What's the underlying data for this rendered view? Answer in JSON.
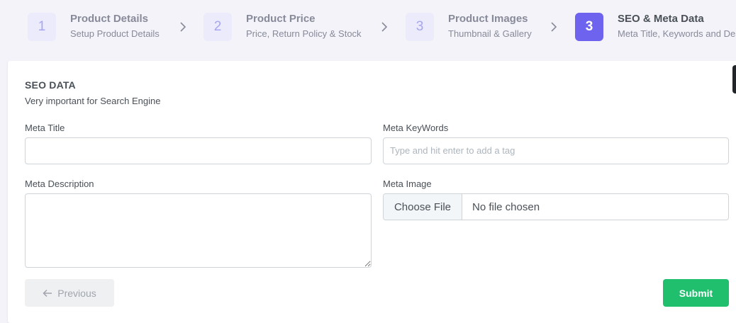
{
  "stepper": {
    "steps": [
      {
        "number": "1",
        "title": "Product Details",
        "subtitle": "Setup Product Details",
        "active": false
      },
      {
        "number": "2",
        "title": "Product Price",
        "subtitle": "Price, Return Policy & Stock",
        "active": false
      },
      {
        "number": "3",
        "title": "Product Images",
        "subtitle": "Thumbnail & Gallery",
        "active": false
      },
      {
        "number": "3",
        "title": "SEO & Meta Data",
        "subtitle": "Meta Title, Keywords and Description",
        "active": true
      }
    ],
    "separator_icon": "chevron-right-icon"
  },
  "section": {
    "title": "SEO DATA",
    "subtitle": "Very important for Search Engine"
  },
  "form": {
    "meta_title": {
      "label": "Meta Title",
      "value": ""
    },
    "meta_keywords": {
      "label": "Meta KeyWords",
      "placeholder": "Type and hit enter to add a tag"
    },
    "meta_description": {
      "label": "Meta Description",
      "value": ""
    },
    "meta_image": {
      "label": "Meta Image",
      "button_label": "Choose File",
      "status": "No file chosen"
    }
  },
  "actions": {
    "previous_label": "Previous",
    "previous_icon": "arrow-left-icon",
    "submit_label": "Submit"
  },
  "colors": {
    "accent": "#6e63ef",
    "submit": "#1fbf6e",
    "background": "#f3f3f9"
  }
}
